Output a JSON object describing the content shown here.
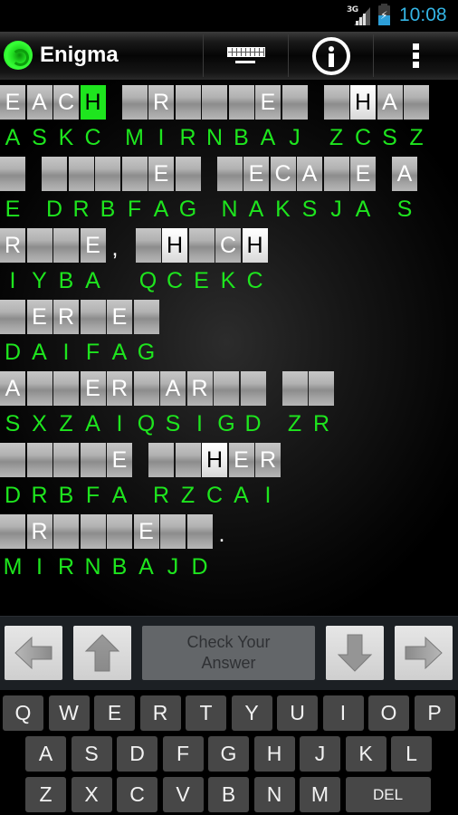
{
  "status_bar": {
    "network": "3G",
    "time": "10:08",
    "battery_charging": true
  },
  "action_bar": {
    "app_title": "Enigma",
    "icons": [
      "app-logo-icon",
      "keyboard-icon",
      "info-icon",
      "overflow-menu-icon"
    ]
  },
  "puzzle": {
    "current_cell": {
      "line": 0,
      "word": 0,
      "index": 3
    },
    "selected_letter": "H",
    "lines": [
      {
        "words": [
          {
            "cells": [
              "E",
              "A",
              "C",
              "H"
            ],
            "code": [
              "A",
              "S",
              "K",
              "C"
            ]
          },
          {
            "cells": [
              "",
              "R",
              "",
              "",
              "",
              "E",
              ""
            ],
            "code": [
              "M",
              "I",
              "R",
              "N",
              "B",
              "A",
              "J"
            ]
          },
          {
            "cells": [
              "",
              "H",
              "A",
              ""
            ],
            "code": [
              "Z",
              "C",
              "S",
              "Z"
            ]
          }
        ]
      },
      {
        "words": [
          {
            "cells": [
              ""
            ],
            "code": [
              "E"
            ]
          },
          {
            "cells": [
              "",
              "",
              "",
              "",
              "E",
              ""
            ],
            "code": [
              "D",
              "R",
              "B",
              "F",
              "A",
              "G"
            ]
          },
          {
            "cells": [
              "",
              "E",
              "C",
              "A",
              "",
              "E"
            ],
            "code": [
              "N",
              "A",
              "K",
              "S",
              "J",
              "A"
            ]
          },
          {
            "cells": [
              "A"
            ],
            "code": [
              "S"
            ]
          }
        ]
      },
      {
        "words": [
          {
            "cells": [
              "R",
              "",
              "",
              "E"
            ],
            "code": [
              "I",
              "Y",
              "B",
              "A"
            ],
            "punct": ","
          },
          {
            "cells": [
              "",
              "H",
              "",
              "C",
              "H"
            ],
            "code": [
              "Q",
              "C",
              "E",
              "K",
              "C"
            ]
          }
        ]
      },
      {
        "words": [
          {
            "cells": [
              "",
              "E",
              "R",
              "",
              "E",
              ""
            ],
            "code": [
              "D",
              "A",
              "I",
              "F",
              "A",
              "G"
            ]
          }
        ]
      },
      {
        "words": [
          {
            "cells": [
              "A",
              "",
              "",
              "E",
              "R",
              "",
              "A",
              "R",
              "",
              ""
            ],
            "code": [
              "S",
              "X",
              "Z",
              "A",
              "I",
              "Q",
              "S",
              "I",
              "G",
              "D"
            ]
          },
          {
            "cells": [
              "",
              ""
            ],
            "code": [
              "Z",
              "R"
            ]
          }
        ]
      },
      {
        "words": [
          {
            "cells": [
              "",
              "",
              "",
              "",
              "E"
            ],
            "code": [
              "D",
              "R",
              "B",
              "F",
              "A"
            ]
          },
          {
            "cells": [
              "",
              "",
              "H",
              "E",
              "R"
            ],
            "code": [
              "R",
              "Z",
              "C",
              "A",
              "I"
            ]
          }
        ]
      },
      {
        "words": [
          {
            "cells": [
              "",
              "R",
              "",
              "",
              "",
              "E",
              "",
              ""
            ],
            "code": [
              "M",
              "I",
              "R",
              "N",
              "B",
              "A",
              "J",
              "D"
            ],
            "punct": "."
          }
        ]
      }
    ]
  },
  "controls": {
    "left_label": "left-arrow",
    "up_label": "up-arrow",
    "check_button": "Check Your Answer",
    "down_label": "down-arrow",
    "right_label": "right-arrow"
  },
  "keyboard": {
    "rows": [
      [
        "Q",
        "W",
        "E",
        "R",
        "T",
        "Y",
        "U",
        "I",
        "O",
        "P"
      ],
      [
        "A",
        "S",
        "D",
        "F",
        "G",
        "H",
        "J",
        "K",
        "L"
      ],
      [
        "Z",
        "X",
        "C",
        "V",
        "B",
        "N",
        "M",
        "DEL"
      ]
    ]
  },
  "colors": {
    "code_green": "#1ee51e",
    "active_cell": "#1ee51e",
    "time_blue": "#34b5e5",
    "key_bg": "#474747",
    "check_bg": "#636669"
  }
}
